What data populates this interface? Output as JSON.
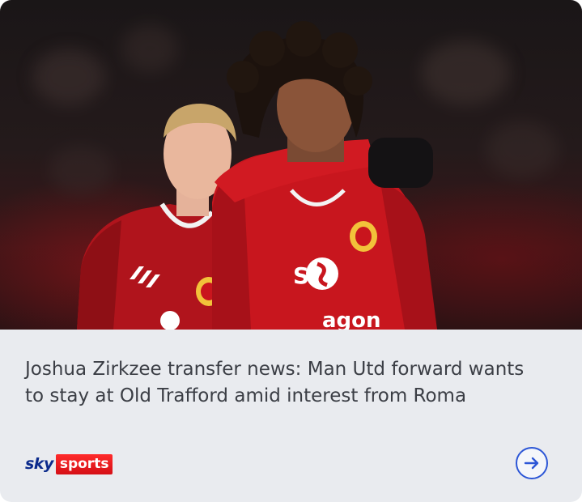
{
  "card": {
    "headline": "Joshua Zirkzee transfer news: Man Utd forward wants to stay at Old Trafford amid interest from Roma",
    "source": {
      "brand_part1": "sky",
      "brand_part2": "sports"
    },
    "open_icon": "arrow-right-icon"
  },
  "photo": {
    "shirt_sponsor_partial": "agon",
    "sponsor_mark": "S"
  },
  "colors": {
    "headline_text": "#3b3e45",
    "brand_blue": "#0b2a8c",
    "brand_red": "#e0141c",
    "arrow_blue": "#2c56d6",
    "card_background": "#e9ebef"
  }
}
